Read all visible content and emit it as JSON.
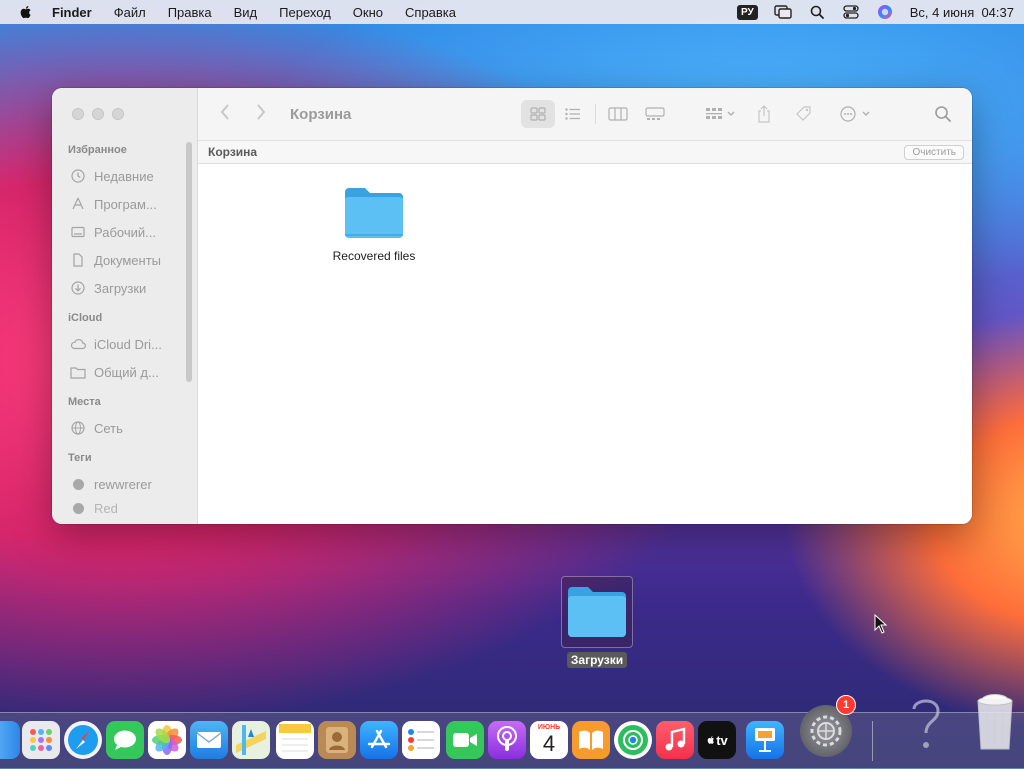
{
  "menubar": {
    "app": "Finder",
    "items": [
      "Файл",
      "Правка",
      "Вид",
      "Переход",
      "Окно",
      "Справка"
    ],
    "input_source": "РУ",
    "clock": "Вс, 4 июня  04:37"
  },
  "window": {
    "title": "Корзина",
    "pathbar_label": "Корзина",
    "empty_button": "Очистить",
    "sidebar": {
      "favorites_header": "Избранное",
      "favorites": [
        {
          "label": "Недавние",
          "icon": "clock-icon"
        },
        {
          "label": "Програм...",
          "icon": "applications-icon"
        },
        {
          "label": "Рабочий...",
          "icon": "desktop-icon"
        },
        {
          "label": "Документы",
          "icon": "document-icon"
        },
        {
          "label": "Загрузки",
          "icon": "download-icon"
        }
      ],
      "icloud_header": "iCloud",
      "icloud": [
        {
          "label": "iCloud Dri...",
          "icon": "cloud-icon"
        },
        {
          "label": "Общий д...",
          "icon": "shared-folder-icon"
        }
      ],
      "locations_header": "Места",
      "locations": [
        {
          "label": "Сеть",
          "icon": "globe-icon"
        }
      ],
      "tags_header": "Теги",
      "tags": [
        {
          "label": "rewwrerer",
          "color": "#a8a8a8"
        },
        {
          "label": "Red",
          "color": "#a8a8a8"
        }
      ]
    },
    "files": [
      {
        "name": "Recovered files",
        "icon": "folder-icon"
      }
    ]
  },
  "desktop": {
    "folder_label": "Загрузки"
  },
  "dock": {
    "calendar_month": "ИЮНЬ",
    "calendar_day": "4",
    "tv_label": "tv",
    "settings_badge": "1"
  },
  "colors": {
    "folder_blue": "#4fb3ee",
    "accent": "#1e88e5"
  }
}
